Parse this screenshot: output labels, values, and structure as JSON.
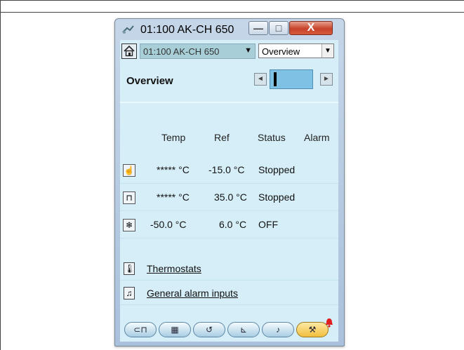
{
  "window": {
    "title": "01:100 AK-CH 650",
    "controls": {
      "minimize": "—",
      "maximize": "□",
      "close": "X"
    }
  },
  "toolbar": {
    "device_combo": "01:100 AK-CH 650",
    "view_combo": "Overview",
    "combo_arrow": "▼"
  },
  "page": {
    "heading": "Overview",
    "pager_prev": "◄",
    "pager_next": "►"
  },
  "table": {
    "headers": [
      "Temp",
      "Ref",
      "Status",
      "Alarm"
    ],
    "rows": [
      {
        "icon": "hand-icon",
        "glyph": "☝",
        "temp": "***** °C",
        "ref": "-15.0 °C",
        "status": "Stopped",
        "alarm": ""
      },
      {
        "icon": "compressor-icon",
        "glyph": "⊓",
        "temp": "***** °C",
        "ref": "35.0 °C",
        "status": "Stopped",
        "alarm": ""
      },
      {
        "icon": "snowflake-icon",
        "glyph": "❄",
        "temp": "-50.0 °C",
        "ref": "6.0 °C",
        "status": "OFF",
        "alarm": ""
      }
    ]
  },
  "links": [
    {
      "icon": "thermometer-icon",
      "glyph": "🌡",
      "label": "Thermostats"
    },
    {
      "icon": "bell-icon",
      "glyph": "♫",
      "label": "General alarm inputs"
    }
  ],
  "navbar": {
    "items": [
      {
        "icon": "plant-icon",
        "glyph": "⊂⊓"
      },
      {
        "icon": "grid-icon",
        "glyph": "▦"
      },
      {
        "icon": "undo-icon",
        "glyph": "↺"
      },
      {
        "icon": "graph-icon",
        "glyph": "⊾"
      },
      {
        "icon": "alarm-bell-icon",
        "glyph": "♪"
      },
      {
        "icon": "wrench-icon",
        "glyph": "⚒"
      }
    ],
    "active_index": 5
  },
  "colors": {
    "client_bg": "#d6eef7",
    "alarm_red": "#e02020",
    "active_tab": "#f0bf3e"
  }
}
